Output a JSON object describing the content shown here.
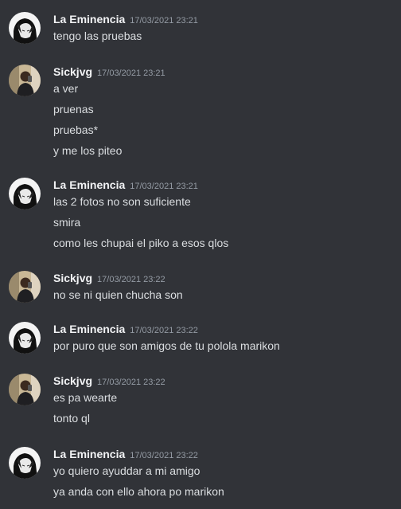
{
  "colors": {
    "background": "#313338",
    "username": "#f2f3f5",
    "timestamp": "#949ba4",
    "message_text": "#dbdee1"
  },
  "groups": [
    {
      "author": "La Eminencia",
      "avatar": "anime-avatar",
      "timestamp": "17/03/2021 23:21",
      "messages": [
        "tengo las pruebas"
      ]
    },
    {
      "author": "Sickjvg",
      "avatar": "photo-avatar",
      "timestamp": "17/03/2021 23:21",
      "messages": [
        "a ver",
        "pruenas",
        "pruebas*",
        "y me los piteo"
      ]
    },
    {
      "author": "La Eminencia",
      "avatar": "anime-avatar",
      "timestamp": "17/03/2021 23:21",
      "messages": [
        "las 2 fotos no son suficiente",
        "smira",
        "como les chupai el piko a esos qlos"
      ]
    },
    {
      "author": "Sickjvg",
      "avatar": "photo-avatar",
      "timestamp": "17/03/2021 23:22",
      "messages": [
        "no se ni quien chucha son"
      ]
    },
    {
      "author": "La Eminencia",
      "avatar": "anime-avatar",
      "timestamp": "17/03/2021 23:22",
      "messages": [
        "por puro que son amigos de tu polola marikon"
      ]
    },
    {
      "author": "Sickjvg",
      "avatar": "photo-avatar",
      "timestamp": "17/03/2021 23:22",
      "messages": [
        "es pa wearte",
        "tonto ql"
      ]
    },
    {
      "author": "La Eminencia",
      "avatar": "anime-avatar",
      "timestamp": "17/03/2021 23:22",
      "messages": [
        "yo quiero ayuddar a mi amigo",
        "ya anda con ello ahora po marikon"
      ]
    }
  ]
}
